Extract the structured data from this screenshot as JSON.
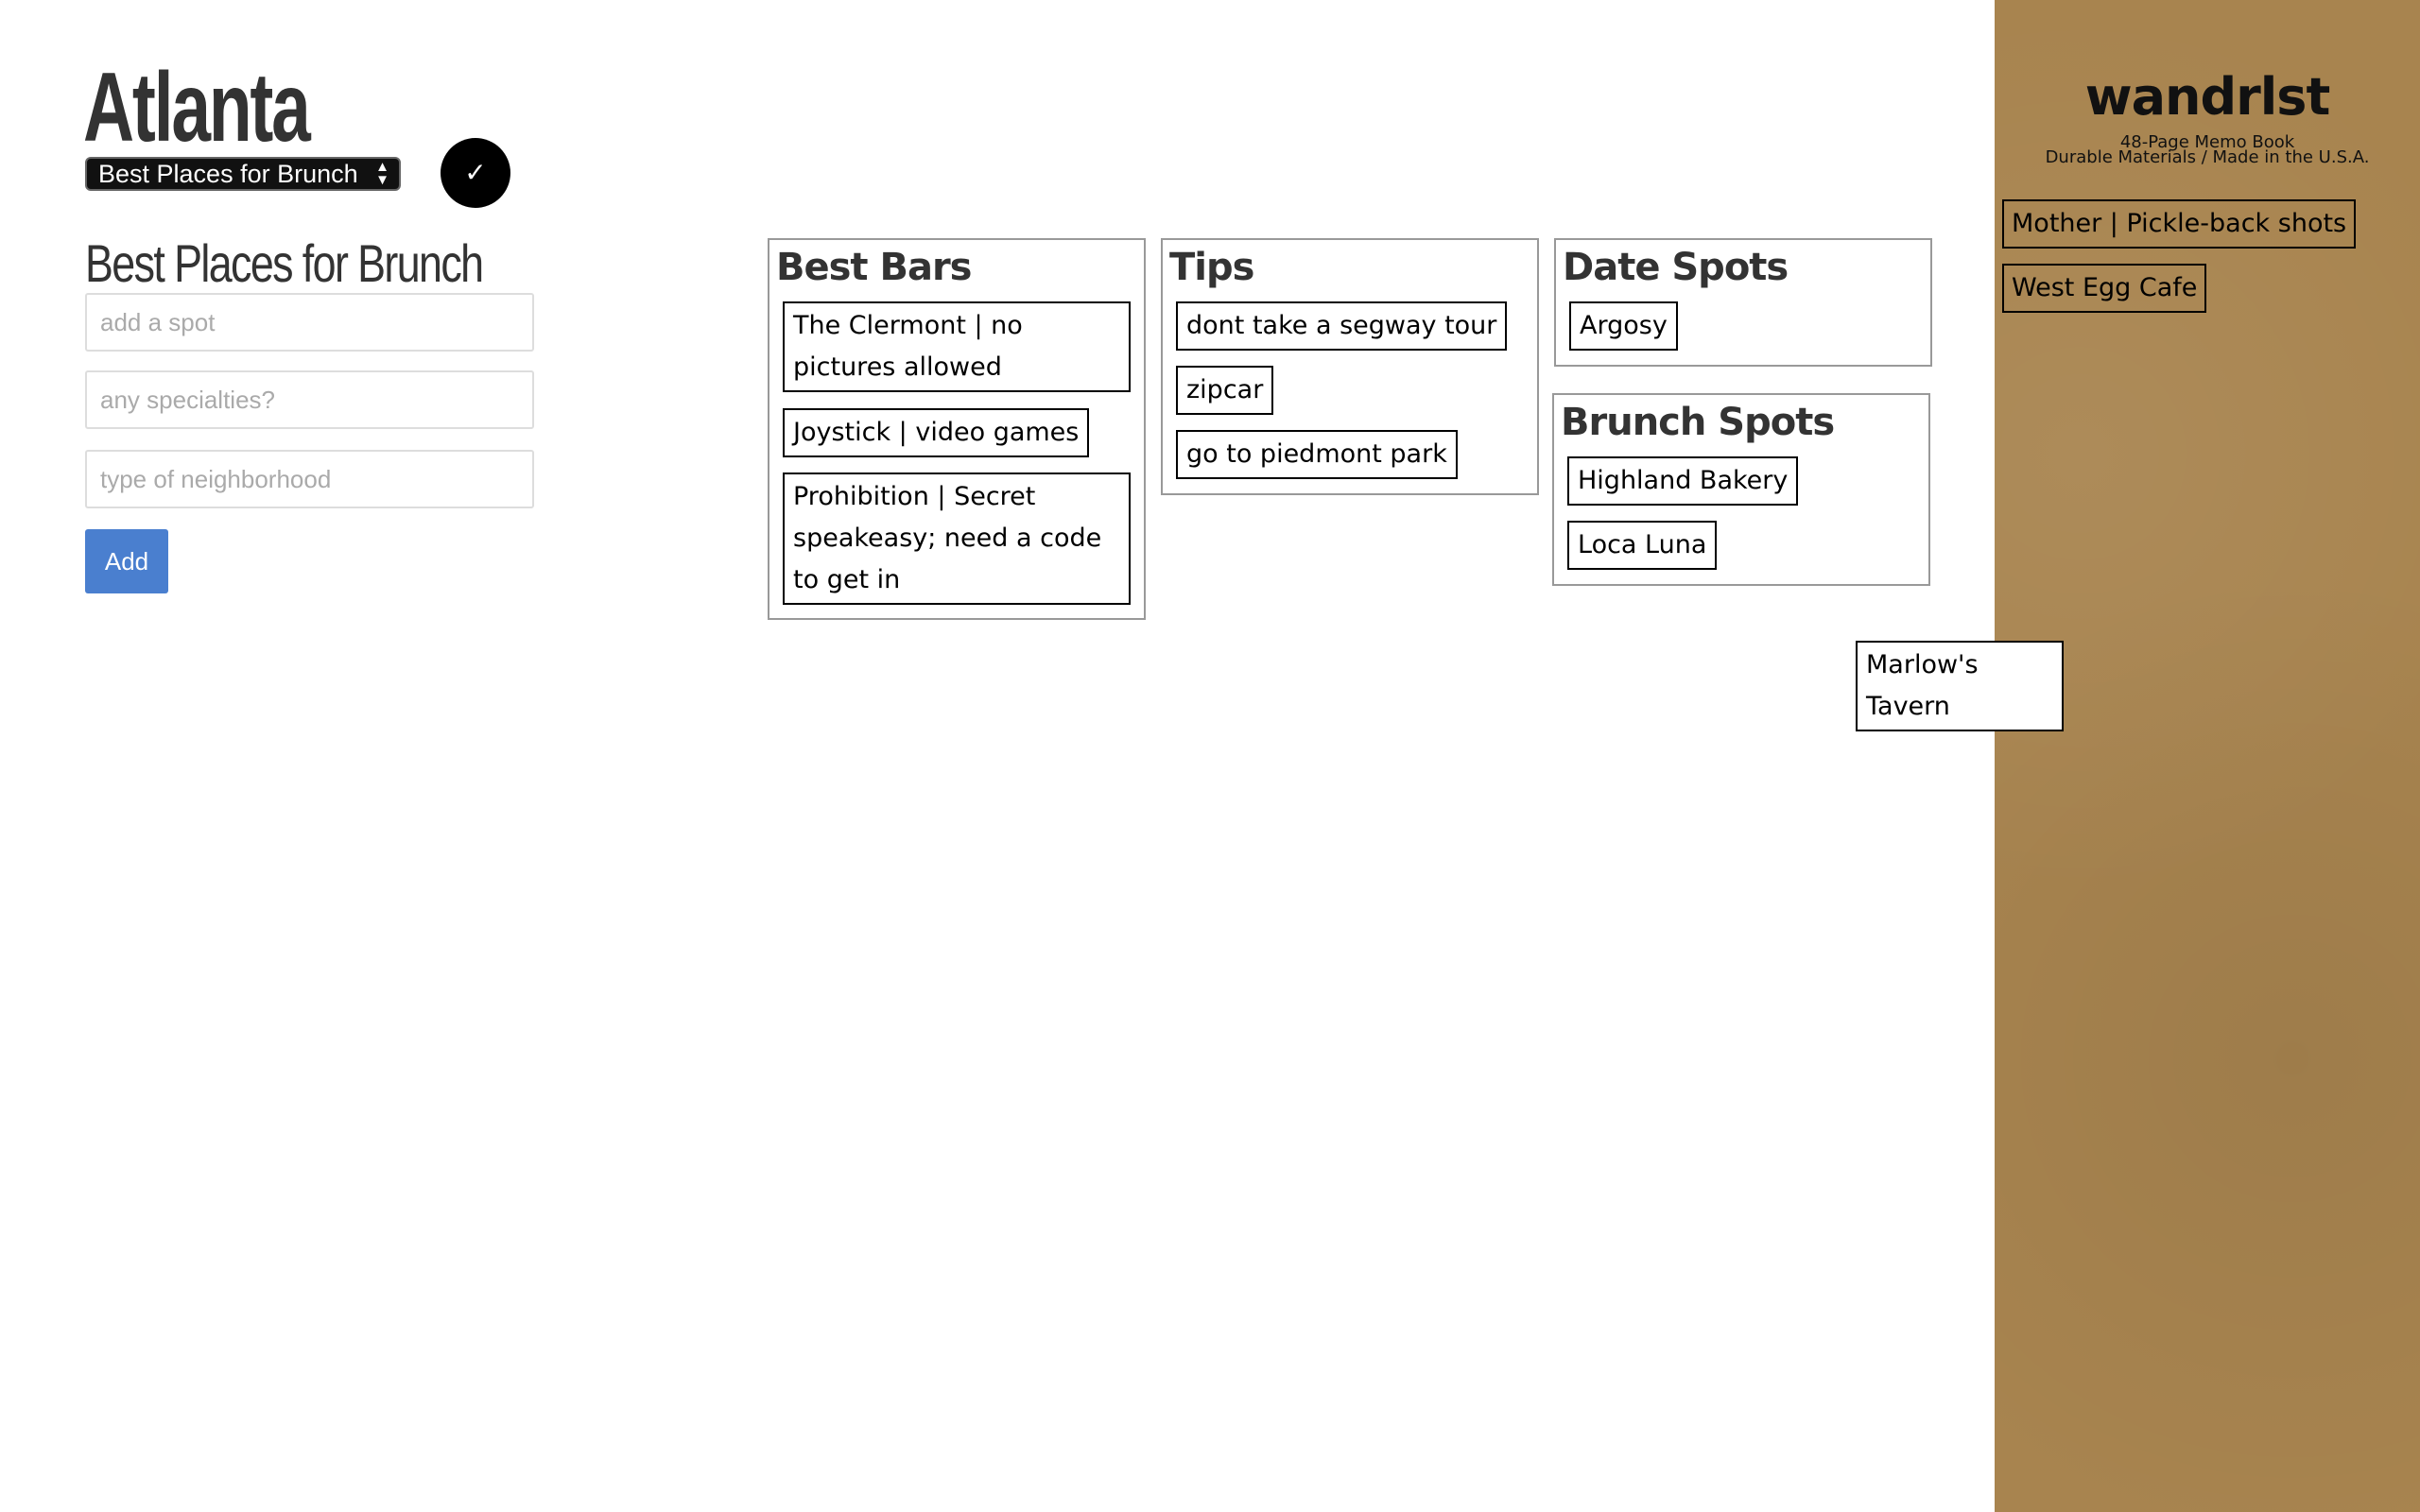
{
  "header": {
    "city": "Atlanta",
    "selected_list": "Best Places for Brunch",
    "confirm_label": "✓",
    "select_arrows": "▲▼"
  },
  "form": {
    "title": "Best Places for Brunch",
    "spot_placeholder": "add a spot",
    "specialties_placeholder": "any specialties?",
    "neighborhood_placeholder": "type of neighborhood",
    "add_label": "Add"
  },
  "boards": {
    "best_bars": {
      "title": "Best Bars",
      "cards": [
        "The Clermont | no pictures allowed",
        "Joystick | video games",
        "Prohibition | Secret speakeasy; need a code to get in"
      ]
    },
    "tips": {
      "title": "Tips",
      "cards": [
        "dont take a segway tour",
        "zipcar",
        "go to piedmont park"
      ]
    },
    "date_spots": {
      "title": "Date Spots",
      "cards": [
        "Argosy"
      ]
    },
    "brunch_spots": {
      "title": "Brunch Spots",
      "cards": [
        "Highland Bakery",
        "Loca Luna"
      ]
    }
  },
  "loose_card": "Marlow's Tavern",
  "sidebar": {
    "brand": "wandrlst",
    "subtitle_1": "48-Page Memo Book",
    "subtitle_2": "Durable Materials / Made in the U.S.A.",
    "cards": [
      "Mother | Pickle-back shots",
      "West Egg Cafe"
    ]
  },
  "colors": {
    "add_button": "#4a7fcf",
    "sidebar": "#a8844f",
    "select_bg": "#111111"
  }
}
